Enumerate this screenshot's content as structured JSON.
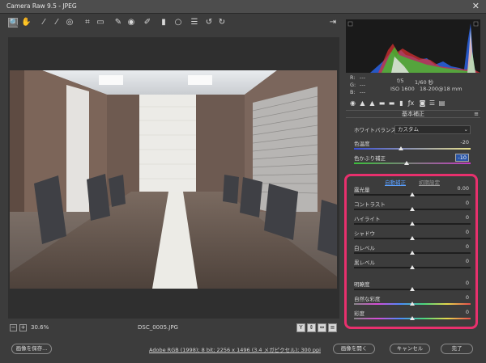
{
  "window": {
    "title": "Camera Raw 9.5 - JPEG",
    "close_glyph": "✕"
  },
  "toolbar": {
    "tools": [
      {
        "icon": "zoom-icon",
        "glyph": "🔍"
      },
      {
        "icon": "hand-icon",
        "glyph": "✋"
      },
      {
        "icon": "white-balance-icon",
        "glyph": "⁄"
      },
      {
        "icon": "color-sampler-icon",
        "glyph": "⁄"
      },
      {
        "icon": "target-adjustment-icon",
        "glyph": "◎"
      },
      {
        "icon": "crop-icon",
        "glyph": "⌗"
      },
      {
        "icon": "straighten-icon",
        "glyph": "▭"
      },
      {
        "icon": "spot-removal-icon",
        "glyph": "✎"
      },
      {
        "icon": "red-eye-icon",
        "glyph": "◉"
      },
      {
        "icon": "adjustment-brush-icon",
        "glyph": "✐"
      },
      {
        "icon": "graduated-filter-icon",
        "glyph": "▮"
      },
      {
        "icon": "radial-filter-icon",
        "glyph": "○"
      },
      {
        "icon": "preferences-icon",
        "glyph": "☰"
      },
      {
        "icon": "rotate-left-icon",
        "glyph": "↺"
      },
      {
        "icon": "rotate-right-icon",
        "glyph": "↻"
      }
    ],
    "export_glyph": "⇥"
  },
  "bottombar": {
    "zoom_out": "−",
    "zoom_in": "+",
    "zoom": "30.6%",
    "filename": "DSC_0005.JPG",
    "view_buttons": [
      "Y",
      "⇕",
      "⇔",
      "≡"
    ]
  },
  "info": {
    "r_label": "R:",
    "g_label": "G:",
    "b_label": "B:",
    "r": "---",
    "g": "---",
    "b": "---",
    "aperture": "f/5",
    "shutter": "1/60 秒",
    "iso": "ISO 1600",
    "lens": "18-200@18 mm"
  },
  "panel": {
    "title": "基本補正",
    "menu_glyph": "≡",
    "tabs": [
      "◉",
      "▲",
      "▲",
      "▬",
      "▬",
      "▮",
      "ƒx",
      "◙",
      "☰",
      "▤"
    ],
    "white_balance_label": "ホワイトバランス :",
    "white_balance_value": "カスタム",
    "temperature": {
      "label": "色温度",
      "value": "-20",
      "pos": 0.4
    },
    "tint": {
      "label": "色かぶり補正",
      "value": "-10",
      "pos": 0.45
    },
    "auto_label": "自動補正",
    "default_label": "初期設定",
    "sliders": [
      {
        "label": "露光量",
        "value": "0.00",
        "pos": 0.5
      },
      {
        "label": "コントラスト",
        "value": "0",
        "pos": 0.5
      },
      {
        "label": "ハイライト",
        "value": "0",
        "pos": 0.5
      },
      {
        "label": "シャドウ",
        "value": "0",
        "pos": 0.5
      },
      {
        "label": "白レベル",
        "value": "0",
        "pos": 0.5
      },
      {
        "label": "黒レベル",
        "value": "0",
        "pos": 0.5
      },
      {
        "label": "明瞭度",
        "value": "0",
        "pos": 0.5
      },
      {
        "label": "自然な彩度",
        "value": "0",
        "pos": 0.5
      },
      {
        "label": "彩度",
        "value": "0",
        "pos": 0.5
      }
    ]
  },
  "footer": {
    "save_label": "画像を保存...",
    "workflow_info": "Adobe RGB (1998); 8 bit; 2256 x 1496 (3.4 メガピクセル); 300 ppi",
    "open_label": "画像を開く",
    "cancel_label": "キャンセル",
    "done_label": "完了"
  },
  "colors": {
    "accent_highlight": "#e8306d",
    "link": "#5aa0ff"
  }
}
